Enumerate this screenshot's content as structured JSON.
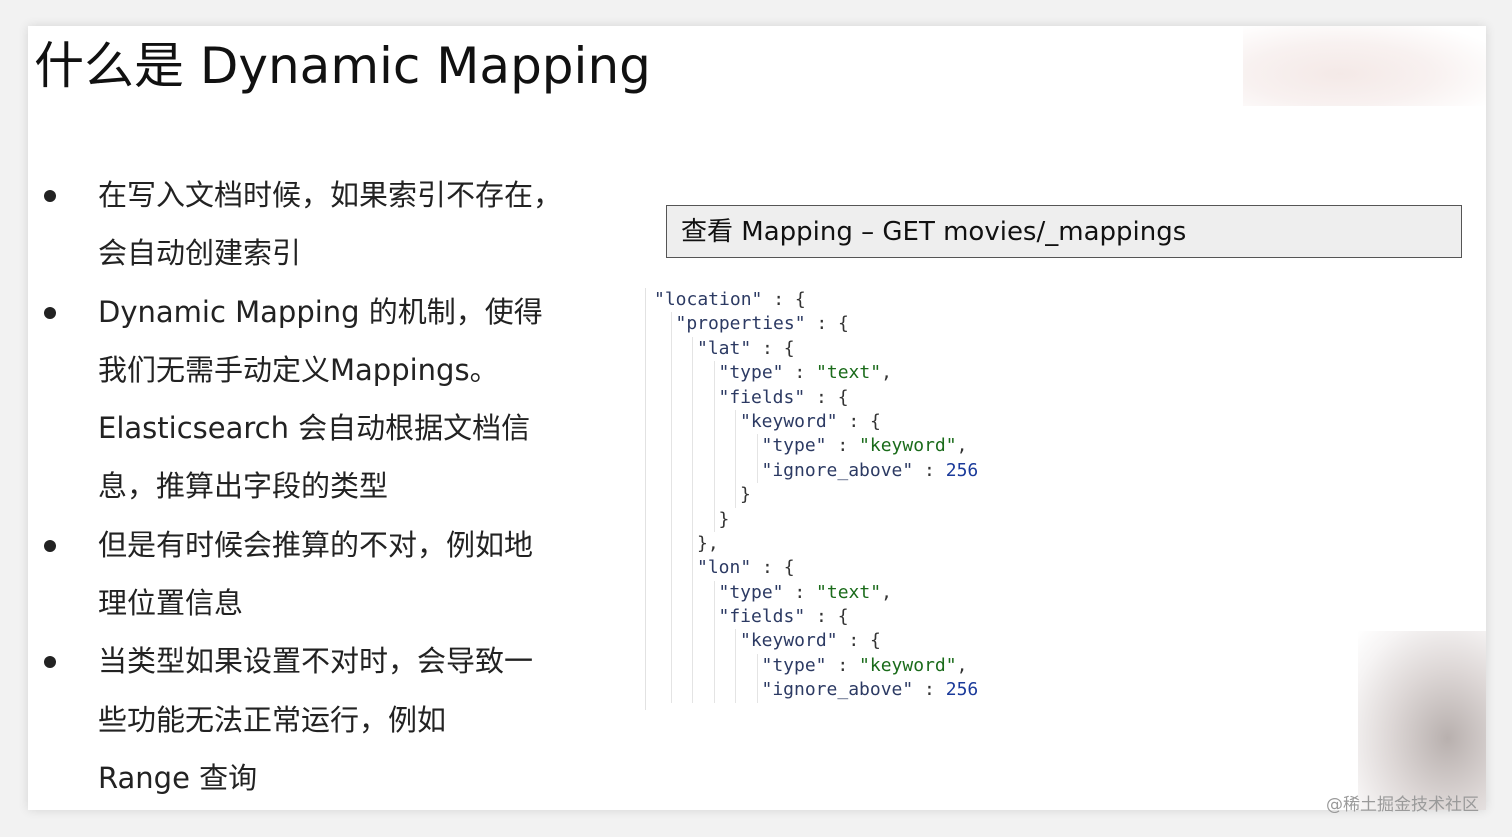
{
  "slide": {
    "title": "什么是 Dynamic Mapping",
    "bullets": [
      {
        "lines": [
          "在写入文档时候，如果索引不存在，",
          "会自动创建索引"
        ]
      },
      {
        "lines": [
          "Dynamic Mapping 的机制，使得",
          "我们无需手动定义Mappings。",
          "Elasticsearch 会自动根据文档信",
          "息，推算出字段的类型"
        ]
      },
      {
        "lines": [
          "但是有时候会推算的不对，例如地",
          "理位置信息"
        ]
      },
      {
        "lines": [
          "当类型如果设置不对时，会导致一",
          "些功能无法正常运行，例如",
          "Range 查询"
        ]
      }
    ],
    "code_header": "查看 Mapping – GET movies/_mappings",
    "code_lines": [
      {
        "indent": 0,
        "parts": [
          [
            "k",
            "\"location\""
          ],
          [
            "p",
            " : {"
          ]
        ]
      },
      {
        "indent": 1,
        "parts": [
          [
            "k",
            "\"properties\""
          ],
          [
            "p",
            " : {"
          ]
        ]
      },
      {
        "indent": 2,
        "parts": [
          [
            "k",
            "\"lat\""
          ],
          [
            "p",
            " : {"
          ]
        ]
      },
      {
        "indent": 3,
        "parts": [
          [
            "k",
            "\"type\""
          ],
          [
            "p",
            " : "
          ],
          [
            "s",
            "\"text\""
          ],
          [
            "p",
            ","
          ]
        ]
      },
      {
        "indent": 3,
        "parts": [
          [
            "k",
            "\"fields\""
          ],
          [
            "p",
            " : {"
          ]
        ]
      },
      {
        "indent": 4,
        "parts": [
          [
            "k",
            "\"keyword\""
          ],
          [
            "p",
            " : {"
          ]
        ]
      },
      {
        "indent": 5,
        "parts": [
          [
            "k",
            "\"type\""
          ],
          [
            "p",
            " : "
          ],
          [
            "s",
            "\"keyword\""
          ],
          [
            "p",
            ","
          ]
        ]
      },
      {
        "indent": 5,
        "parts": [
          [
            "k",
            "\"ignore_above\""
          ],
          [
            "p",
            " : "
          ],
          [
            "n",
            "256"
          ]
        ]
      },
      {
        "indent": 4,
        "parts": [
          [
            "p",
            "}"
          ]
        ]
      },
      {
        "indent": 3,
        "parts": [
          [
            "p",
            "}"
          ]
        ]
      },
      {
        "indent": 2,
        "parts": [
          [
            "p",
            "},"
          ]
        ]
      },
      {
        "indent": 2,
        "parts": [
          [
            "k",
            "\"lon\""
          ],
          [
            "p",
            " : {"
          ]
        ]
      },
      {
        "indent": 3,
        "parts": [
          [
            "k",
            "\"type\""
          ],
          [
            "p",
            " : "
          ],
          [
            "s",
            "\"text\""
          ],
          [
            "p",
            ","
          ]
        ]
      },
      {
        "indent": 3,
        "parts": [
          [
            "k",
            "\"fields\""
          ],
          [
            "p",
            " : {"
          ]
        ]
      },
      {
        "indent": 4,
        "parts": [
          [
            "k",
            "\"keyword\""
          ],
          [
            "p",
            " : {"
          ]
        ]
      },
      {
        "indent": 5,
        "parts": [
          [
            "k",
            "\"type\""
          ],
          [
            "p",
            " : "
          ],
          [
            "s",
            "\"keyword\""
          ],
          [
            "p",
            ","
          ]
        ]
      },
      {
        "indent": 5,
        "parts": [
          [
            "k",
            "\"ignore_above\""
          ],
          [
            "p",
            " : "
          ],
          [
            "n",
            "256"
          ]
        ]
      }
    ],
    "colors": {
      "key": "#2c3a63",
      "string": "#1a6b1a",
      "number": "#1a3a9a"
    }
  },
  "watermark": "@稀土掘金技术社区"
}
